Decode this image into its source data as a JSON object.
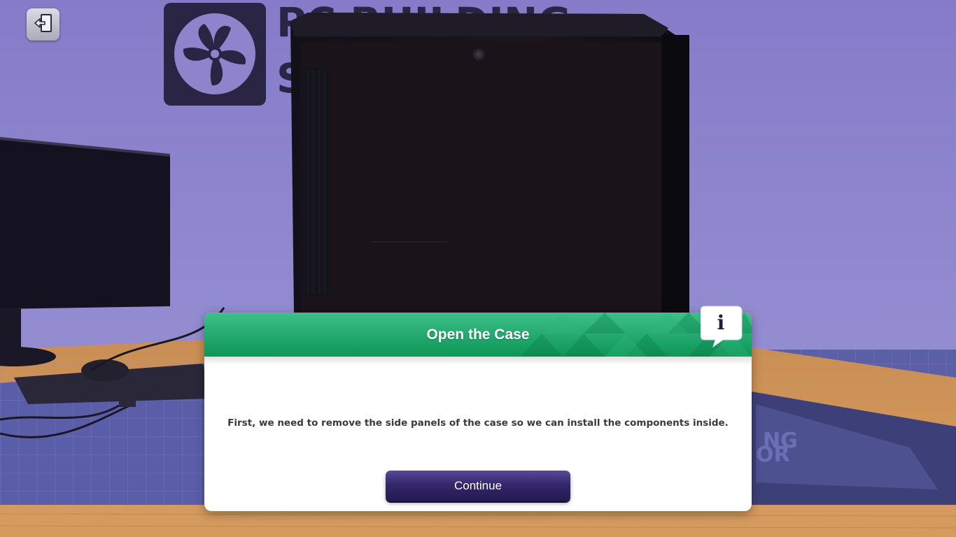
{
  "game": {
    "exit_icon": "exit-door-icon",
    "background_logo_icon": "fan-icon"
  },
  "dialog": {
    "title": "Open the Case",
    "info_icon": "info-speech-bubble-icon",
    "body": "First, we need to remove the side panels of the case so we can install the components inside.",
    "continue_label": "Continue"
  },
  "colors": {
    "header_green": "#0c9657",
    "button_purple": "#33286a",
    "wall_purple": "#8f84cc"
  }
}
